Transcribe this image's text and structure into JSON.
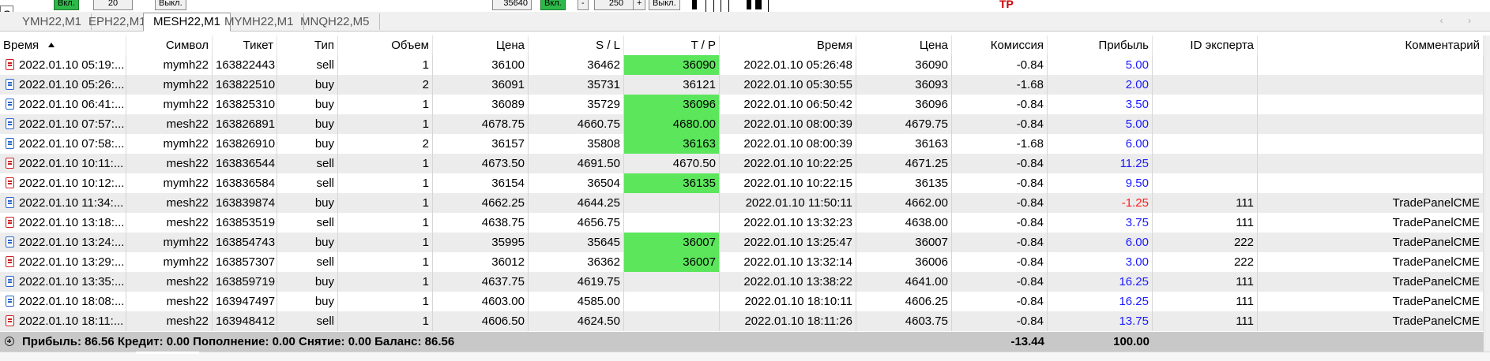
{
  "top": {
    "checkbox_letter": "C",
    "btn1": "Вкл.",
    "btn2": "Выкл.",
    "spin1_value": "20",
    "price_readout": "35640",
    "btn3": "Вкл.",
    "spin2_minus": "-",
    "spin2_value": "250",
    "spin2_plus": "+",
    "btn4": "Выкл.",
    "tp_label": "TP"
  },
  "tabs": [
    "YMH22,M1",
    "EPH22,M1",
    "MESH22,M1",
    "MYMH22,M1",
    "MNQH22,M5"
  ],
  "active_tab": "MESH22,M1",
  "nav_arrows": "‹ ›",
  "columns": [
    "Время",
    "Символ",
    "Тикет",
    "Тип",
    "Объем",
    "Цена",
    "S / L",
    "T / P",
    "Время",
    "Цена",
    "Комиссия",
    "Прибыль",
    "ID эксперта",
    "Комментарий"
  ],
  "rows": [
    {
      "side": "sell",
      "time_open": "2022.01.10 05:19:...",
      "symbol": "mymh22",
      "ticket": "163822443",
      "type": "sell",
      "volume": "1",
      "price": "36100",
      "sl": "36462",
      "tp": "36090",
      "tp_hit": true,
      "time_close": "2022.01.10 05:26:48",
      "price_close": "36090",
      "commission": "-0.84",
      "profit": "5.00",
      "profit_neg": false,
      "expert_id": "",
      "comment": ""
    },
    {
      "side": "buy",
      "time_open": "2022.01.10 05:26:...",
      "symbol": "mymh22",
      "ticket": "163822510",
      "type": "buy",
      "volume": "2",
      "price": "36091",
      "sl": "35731",
      "tp": "36121",
      "tp_hit": false,
      "time_close": "2022.01.10 05:30:55",
      "price_close": "36093",
      "commission": "-1.68",
      "profit": "2.00",
      "profit_neg": false,
      "expert_id": "",
      "comment": ""
    },
    {
      "side": "buy",
      "time_open": "2022.01.10 06:41:...",
      "symbol": "mymh22",
      "ticket": "163825310",
      "type": "buy",
      "volume": "1",
      "price": "36089",
      "sl": "35729",
      "tp": "36096",
      "tp_hit": true,
      "time_close": "2022.01.10 06:50:42",
      "price_close": "36096",
      "commission": "-0.84",
      "profit": "3.50",
      "profit_neg": false,
      "expert_id": "",
      "comment": ""
    },
    {
      "side": "buy",
      "time_open": "2022.01.10 07:57:...",
      "symbol": "mesh22",
      "ticket": "163826891",
      "type": "buy",
      "volume": "1",
      "price": "4678.75",
      "sl": "4660.75",
      "tp": "4680.00",
      "tp_hit": true,
      "time_close": "2022.01.10 08:00:39",
      "price_close": "4679.75",
      "commission": "-0.84",
      "profit": "5.00",
      "profit_neg": false,
      "expert_id": "",
      "comment": ""
    },
    {
      "side": "buy",
      "time_open": "2022.01.10 07:58:...",
      "symbol": "mymh22",
      "ticket": "163826910",
      "type": "buy",
      "volume": "2",
      "price": "36157",
      "sl": "35808",
      "tp": "36163",
      "tp_hit": true,
      "time_close": "2022.01.10 08:00:39",
      "price_close": "36163",
      "commission": "-1.68",
      "profit": "6.00",
      "profit_neg": false,
      "expert_id": "",
      "comment": ""
    },
    {
      "side": "sell",
      "time_open": "2022.01.10 10:11:...",
      "symbol": "mesh22",
      "ticket": "163836544",
      "type": "sell",
      "volume": "1",
      "price": "4673.50",
      "sl": "4691.50",
      "tp": "4670.50",
      "tp_hit": false,
      "time_close": "2022.01.10 10:22:25",
      "price_close": "4671.25",
      "commission": "-0.84",
      "profit": "11.25",
      "profit_neg": false,
      "expert_id": "",
      "comment": ""
    },
    {
      "side": "sell",
      "time_open": "2022.01.10 10:12:...",
      "symbol": "mymh22",
      "ticket": "163836584",
      "type": "sell",
      "volume": "1",
      "price": "36154",
      "sl": "36504",
      "tp": "36135",
      "tp_hit": true,
      "time_close": "2022.01.10 10:22:15",
      "price_close": "36135",
      "commission": "-0.84",
      "profit": "9.50",
      "profit_neg": false,
      "expert_id": "",
      "comment": ""
    },
    {
      "side": "buy",
      "time_open": "2022.01.10 11:34:...",
      "symbol": "mesh22",
      "ticket": "163839874",
      "type": "buy",
      "volume": "1",
      "price": "4662.25",
      "sl": "4644.25",
      "tp": "",
      "tp_hit": false,
      "time_close": "2022.01.10 11:50:11",
      "price_close": "4662.00",
      "commission": "-0.84",
      "profit": "-1.25",
      "profit_neg": true,
      "expert_id": "111",
      "comment": "TradePanelCME"
    },
    {
      "side": "sell",
      "time_open": "2022.01.10 13:18:...",
      "symbol": "mesh22",
      "ticket": "163853519",
      "type": "sell",
      "volume": "1",
      "price": "4638.75",
      "sl": "4656.75",
      "tp": "",
      "tp_hit": false,
      "time_close": "2022.01.10 13:32:23",
      "price_close": "4638.00",
      "commission": "-0.84",
      "profit": "3.75",
      "profit_neg": false,
      "expert_id": "111",
      "comment": "TradePanelCME"
    },
    {
      "side": "buy",
      "time_open": "2022.01.10 13:24:...",
      "symbol": "mymh22",
      "ticket": "163854743",
      "type": "buy",
      "volume": "1",
      "price": "35995",
      "sl": "35645",
      "tp": "36007",
      "tp_hit": true,
      "time_close": "2022.01.10 13:25:47",
      "price_close": "36007",
      "commission": "-0.84",
      "profit": "6.00",
      "profit_neg": false,
      "expert_id": "222",
      "comment": "TradePanelCME"
    },
    {
      "side": "sell",
      "time_open": "2022.01.10 13:29:...",
      "symbol": "mymh22",
      "ticket": "163857307",
      "type": "sell",
      "volume": "1",
      "price": "36012",
      "sl": "36362",
      "tp": "36007",
      "tp_hit": true,
      "time_close": "2022.01.10 13:32:14",
      "price_close": "36006",
      "commission": "-0.84",
      "profit": "3.00",
      "profit_neg": false,
      "expert_id": "222",
      "comment": "TradePanelCME"
    },
    {
      "side": "buy",
      "time_open": "2022.01.10 13:35:...",
      "symbol": "mesh22",
      "ticket": "163859719",
      "type": "buy",
      "volume": "1",
      "price": "4637.75",
      "sl": "4619.75",
      "tp": "",
      "tp_hit": false,
      "time_close": "2022.01.10 13:38:22",
      "price_close": "4641.00",
      "commission": "-0.84",
      "profit": "16.25",
      "profit_neg": false,
      "expert_id": "111",
      "comment": "TradePanelCME"
    },
    {
      "side": "buy",
      "time_open": "2022.01.10 18:08:...",
      "symbol": "mesh22",
      "ticket": "163947497",
      "type": "buy",
      "volume": "1",
      "price": "4603.00",
      "sl": "4585.00",
      "tp": "",
      "tp_hit": false,
      "time_close": "2022.01.10 18:10:11",
      "price_close": "4606.25",
      "commission": "-0.84",
      "profit": "16.25",
      "profit_neg": false,
      "expert_id": "111",
      "comment": "TradePanelCME"
    },
    {
      "side": "sell",
      "time_open": "2022.01.10 18:11:...",
      "symbol": "mesh22",
      "ticket": "163948412",
      "type": "sell",
      "volume": "1",
      "price": "4606.50",
      "sl": "4624.50",
      "tp": "",
      "tp_hit": false,
      "time_close": "2022.01.10 18:11:26",
      "price_close": "4603.75",
      "commission": "-0.84",
      "profit": "13.75",
      "profit_neg": false,
      "expert_id": "111",
      "comment": "TradePanelCME"
    }
  ],
  "summary": {
    "text": "Прибыль: 86.56  Кредит: 0.00  Пополнение: 0.00  Снятие: 0.00  Баланс: 86.56",
    "commission_total": "-13.44",
    "profit_total": "100.00"
  },
  "colors": {
    "tp_hit": "#5ce65c",
    "profit_pos": "#1a1aff",
    "profit_neg": "#ff1a1a",
    "row_alt": "#ececec",
    "summary_bg": "#c8c8c8"
  }
}
